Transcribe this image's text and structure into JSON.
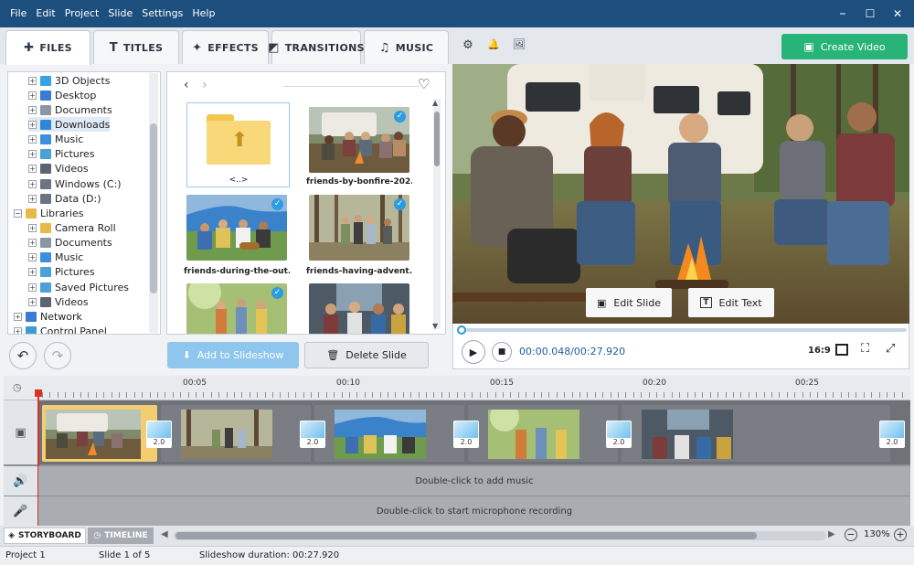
{
  "menu": [
    "File",
    "Edit",
    "Project",
    "Slide",
    "Settings",
    "Help"
  ],
  "window_controls": {
    "minimize": "–",
    "maximize": "☐",
    "close": "✕"
  },
  "tabs": [
    {
      "label": "FILES",
      "icon": "file-plus-icon",
      "glyph": "✚",
      "active": true
    },
    {
      "label": "TITLES",
      "icon": "text-t-icon",
      "glyph": "T",
      "active": false
    },
    {
      "label": "EFFECTS",
      "icon": "effects-hand-icon",
      "glyph": "✦",
      "active": false
    },
    {
      "label": "TRANSITIONS",
      "icon": "transitions-icon",
      "glyph": "◩",
      "active": false
    },
    {
      "label": "MUSIC",
      "icon": "music-note-icon",
      "glyph": "♫",
      "active": false
    }
  ],
  "tab_tools": {
    "settings": "⚙",
    "bell": "🔔",
    "gallery": "🖼"
  },
  "create_video": "Create Video",
  "tree": [
    {
      "label": "3D Objects",
      "indent": 1,
      "color": "#36a3e6"
    },
    {
      "label": "Desktop",
      "indent": 1,
      "color": "#3a7bd5"
    },
    {
      "label": "Documents",
      "indent": 1,
      "color": "#8b95a3"
    },
    {
      "label": "Downloads",
      "indent": 1,
      "color": "#2f86d8",
      "highlight": true
    },
    {
      "label": "Music",
      "indent": 1,
      "color": "#3b8ee0"
    },
    {
      "label": "Pictures",
      "indent": 1,
      "color": "#4aa0d8"
    },
    {
      "label": "Videos",
      "indent": 1,
      "color": "#5b6470"
    },
    {
      "label": "Windows (C:)",
      "indent": 1,
      "color": "#6b7480"
    },
    {
      "label": "Data (D:)",
      "indent": 1,
      "color": "#6b7480"
    },
    {
      "label": "Libraries",
      "indent": 0,
      "color": "#e7b94a",
      "open": true
    },
    {
      "label": "Camera Roll",
      "indent": 1,
      "color": "#e7b94a"
    },
    {
      "label": "Documents",
      "indent": 1,
      "color": "#8b95a3"
    },
    {
      "label": "Music",
      "indent": 1,
      "color": "#3b8ee0"
    },
    {
      "label": "Pictures",
      "indent": 1,
      "color": "#4aa0d8"
    },
    {
      "label": "Saved Pictures",
      "indent": 1,
      "color": "#4aa0d8"
    },
    {
      "label": "Videos",
      "indent": 1,
      "color": "#5b6470"
    },
    {
      "label": "Network",
      "indent": 0,
      "color": "#3a7bd5"
    },
    {
      "label": "Control Panel",
      "indent": 0,
      "color": "#3a9bd5"
    }
  ],
  "files": [
    {
      "label": "<..>",
      "folder": true
    },
    {
      "label": "friends-by-bonfire-202...",
      "checked": true
    },
    {
      "label": "friends-during-the-out...",
      "checked": true
    },
    {
      "label": "friends-having-advent...",
      "checked": true
    },
    {
      "label": "",
      "checked": true
    },
    {
      "label": "",
      "checked": false
    }
  ],
  "add_to_slideshow": "Add to Slideshow",
  "delete_slide": "Delete Slide",
  "edit_slide": "Edit Slide",
  "edit_text": "Edit Text",
  "time_current": "00:00.048",
  "time_separator": "/",
  "time_total": "00:27.920",
  "playback_progress": 0.002,
  "aspect": "16:9",
  "ruler_ticks": [
    "00:05",
    "00:10",
    "00:15",
    "00:20",
    "00:25"
  ],
  "transition_duration": "2.0",
  "music_lane": "Double-click to add music",
  "mic_lane": "Double-click to start microphone recording",
  "storyboard_tab": "STORYBOARD",
  "timeline_tab": "TIMELINE",
  "zoom": "130%",
  "status": {
    "project": "Project 1",
    "slide": "Slide 1 of 5",
    "duration": "Slideshow duration: 00:27.920"
  }
}
